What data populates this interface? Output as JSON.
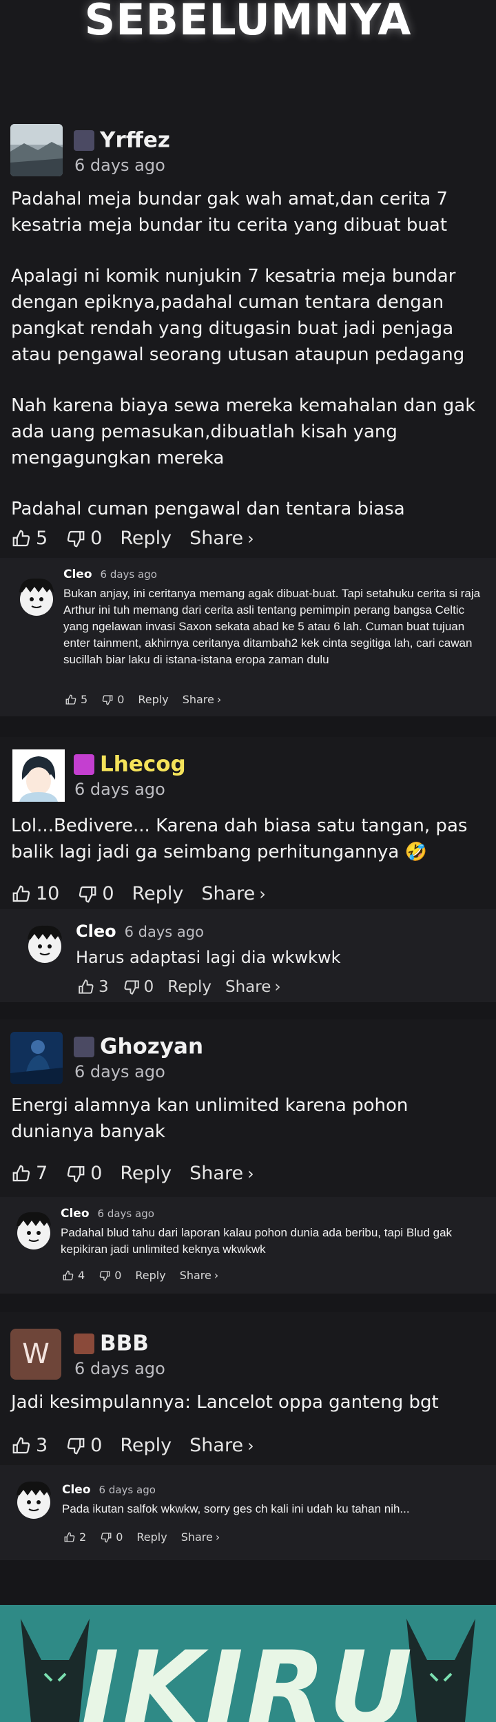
{
  "header": {
    "title": "SEBELUMNYA"
  },
  "comments": [
    {
      "user": "Yrffez",
      "time": "6 days ago",
      "paragraphs": [
        "Padahal meja bundar gak wah amat,dan cerita 7 kesatria meja bundar itu cerita yang dibuat buat",
        "Apalagi ni komik nunjukin 7 kesatria meja bundar dengan epiknya,padahal cuman tentara dengan pangkat rendah yang ditugasin buat jadi penjaga atau pengawal seorang utusan ataupun pedagang",
        "Nah karena biaya sewa mereka kemahalan dan gak ada uang pemasukan,dibuatlah kisah yang mengagungkan mereka",
        "Padahal cuman pengawal dan tentara biasa"
      ],
      "likes": "5",
      "dislikes": "0",
      "reply_label": "Reply",
      "share_label": "Share",
      "reply": {
        "user": "Cleo",
        "time": "6 days ago",
        "text": "Bukan anjay, ini ceritanya memang agak dibuat-buat. Tapi setahuku cerita si raja Arthur ini tuh memang dari cerita asli tentang pemimpin perang bangsa Celtic yang ngelawan invasi Saxon sekata abad ke 5 atau 6 lah. Cuman buat tujuan enter tainment, akhirnya ceritanya ditambah2 kek cinta segitiga lah, cari cawan sucillah biar laku di istana-istana eropa zaman dulu",
        "likes": "5",
        "dislikes": "0",
        "reply_label": "Reply",
        "share_label": "Share"
      }
    },
    {
      "user": "Lhecog",
      "time": "6 days ago",
      "name_color": "#f5e35a",
      "paragraphs": [
        "Lol...Bedivere... Karena dah biasa satu tangan, pas balik lagi jadi ga seimbang perhitungannya 🤣"
      ],
      "likes": "10",
      "dislikes": "0",
      "reply_label": "Reply",
      "share_label": "Share",
      "reply": {
        "user": "Cleo",
        "time": "6 days ago",
        "text": "Harus adaptasi lagi dia wkwkwk",
        "likes": "3",
        "dislikes": "0",
        "reply_label": "Reply",
        "share_label": "Share"
      }
    },
    {
      "user": "Ghozyan",
      "time": "6 days ago",
      "paragraphs": [
        "Energi alamnya kan unlimited karena pohon dunianya banyak"
      ],
      "likes": "7",
      "dislikes": "0",
      "reply_label": "Reply",
      "share_label": "Share",
      "reply": {
        "user": "Cleo",
        "time": "6 days ago",
        "text": "Padahal blud tahu dari laporan kalau pohon dunia ada beribu, tapi Blud gak kepikiran jadi unlimited keknya wkwkwk",
        "likes": "4",
        "dislikes": "0",
        "reply_label": "Reply",
        "share_label": "Share"
      }
    },
    {
      "user": "BBB",
      "avatar_letter": "W",
      "time": "6 days ago",
      "paragraphs": [
        "Jadi kesimpulannya: Lancelot oppa ganteng bgt"
      ],
      "likes": "3",
      "dislikes": "0",
      "reply_label": "Reply",
      "share_label": "Share",
      "reply": {
        "user": "Cleo",
        "time": "6 days ago",
        "text": "Pada ikutan salfok wkwkw, sorry ges ch kali ini udah ku tahan nih...",
        "likes": "2",
        "dislikes": "0",
        "reply_label": "Reply",
        "share_label": "Share"
      }
    }
  ],
  "banner": {
    "title": "IKIRU"
  },
  "colors": {
    "background": "#161619",
    "card": "#19191c",
    "reply_bg": "#1f1f23",
    "accent_name": "#f5e35a",
    "banner": "#2f8a86"
  }
}
